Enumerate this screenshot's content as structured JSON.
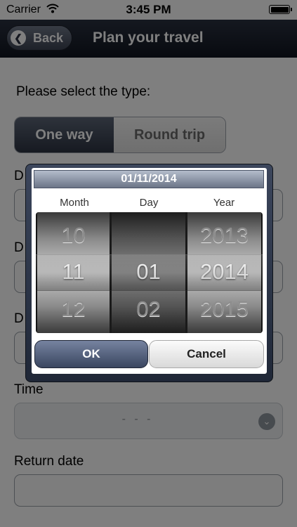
{
  "status_bar": {
    "carrier": "Carrier",
    "time": "3:45 PM"
  },
  "nav": {
    "back_label": "Back",
    "title": "Plan your travel"
  },
  "form": {
    "type_prompt": "Please select the type:",
    "segments": [
      "One way",
      "Round trip"
    ],
    "field_label_initial": "D",
    "time_label": "Time",
    "time_value": "- - -",
    "return_date_label": "Return date"
  },
  "dialog": {
    "title": "01/11/2014",
    "columns": {
      "month": "Month",
      "day": "Day",
      "year": "Year"
    },
    "month_values": [
      "10",
      "11",
      "12"
    ],
    "day_values": [
      "",
      "01",
      "02"
    ],
    "year_values": [
      "2013",
      "2014",
      "2015"
    ],
    "ok_label": "OK",
    "cancel_label": "Cancel"
  }
}
